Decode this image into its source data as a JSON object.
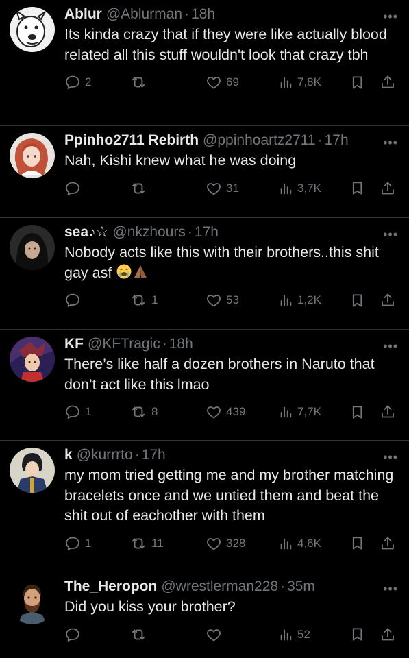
{
  "tweets": [
    {
      "name": "Ablur",
      "handle": "@Ablurman",
      "time": "18h",
      "text": "Its kinda crazy that if they were like actually blood related all this stuff wouldn't look that crazy tbh",
      "replies": "2",
      "retweets": "",
      "likes": "69",
      "views": "7,8K"
    },
    {
      "name": "Ppinho2711 Rebirth",
      "handle": "@ppinhoartz2711",
      "time": "17h",
      "text": "Nah, Kishi knew what he was doing",
      "replies": "",
      "retweets": "",
      "likes": "31",
      "views": "3,7K"
    },
    {
      "name": "sea♪☆",
      "handle": "@nkzhours",
      "time": "17h",
      "text": "Nobody acts like this with their brothers..this shit gay asf",
      "emojis": [
        "crying-face-emoji",
        "folded-hands-emoji"
      ],
      "replies": "",
      "retweets": "1",
      "likes": "53",
      "views": "1,2K"
    },
    {
      "name": "KF",
      "handle": "@KFTragic",
      "time": "18h",
      "text": "There’s like half a dozen brothers in Naruto that don’t act like this lmao",
      "replies": "1",
      "retweets": "8",
      "likes": "439",
      "views": "7,7K"
    },
    {
      "name": "k",
      "handle": "@kurrrto",
      "time": "17h",
      "text": "my mom tried getting me and my brother matching bracelets once and we untied them and beat the shit out of eachother with them",
      "replies": "1",
      "retweets": "11",
      "likes": "328",
      "views": "4,6K"
    },
    {
      "name": "The_Heropon",
      "handle": "@wrestlerman228",
      "time": "35m",
      "text": "Did you kiss your brother?",
      "replies": "",
      "retweets": "",
      "likes": "",
      "views": "52"
    }
  ],
  "separator": "·",
  "more_glyph": "•••",
  "colors": {
    "background": "#000000",
    "text": "#e7e9ea",
    "muted": "#71767b",
    "divider": "#2f3336"
  }
}
